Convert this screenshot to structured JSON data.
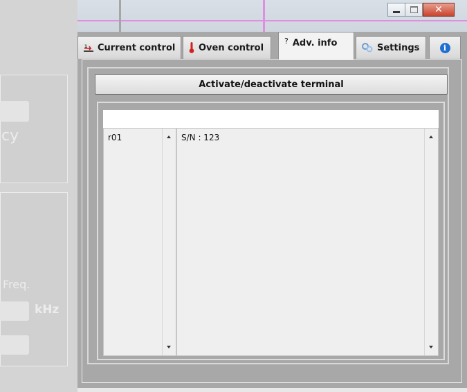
{
  "background": {
    "ghost_text_cy": "cy",
    "ghost_text_freq": "Freq.",
    "ghost_text_khz": "kHz"
  },
  "window": {
    "tabs": [
      {
        "label": "Current control",
        "icon": "current-arrow-icon",
        "active": false
      },
      {
        "label": "Oven control",
        "icon": "thermometer-icon",
        "active": false
      },
      {
        "label": "Adv. info",
        "icon": "question-mark-icon",
        "active": true
      },
      {
        "label": "Settings",
        "icon": "gears-icon",
        "active": false
      },
      {
        "label": "",
        "icon": "info-icon",
        "active": false
      }
    ],
    "activate_button": "Activate/deactivate terminal",
    "terminal_input": {
      "value": "",
      "placeholder": ""
    },
    "left_list": {
      "text": "r01"
    },
    "right_list": {
      "text": "S/N : 123"
    }
  },
  "colors": {
    "pink_accent": "#e08fe0",
    "panel_gray": "#a8a8a8",
    "close_red": "#c8442e",
    "thermometer_red": "#d02020",
    "info_blue": "#1f6fd1"
  }
}
